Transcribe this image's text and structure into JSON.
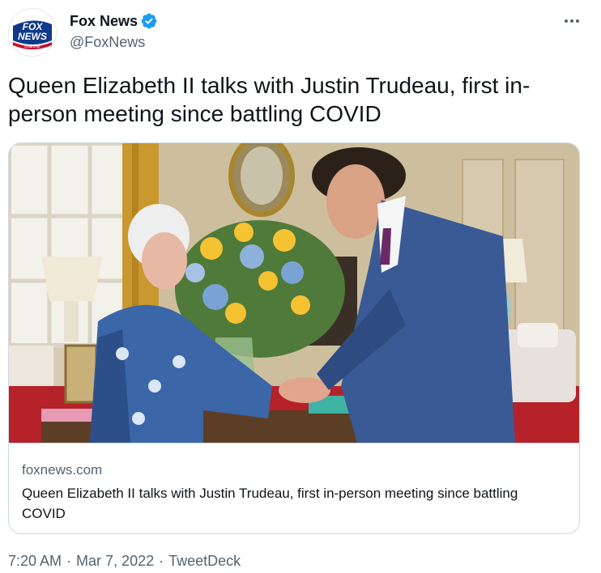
{
  "author": {
    "name": "Fox News",
    "handle": "@FoxNews",
    "verified": true,
    "avatar_logo": {
      "line1": "FOX",
      "line2": "NEWS",
      "line3": "channel"
    }
  },
  "tweet": {
    "text": "Queen Elizabeth II talks with Justin Trudeau, first in-person meeting since battling COVID"
  },
  "card": {
    "domain": "foxnews.com",
    "title": "Queen Elizabeth II talks with Justin Trudeau, first in-person meeting since battling COVID"
  },
  "meta": {
    "time": "7:20 AM",
    "date": "Mar 7, 2022",
    "source": "TweetDeck",
    "separator": "·"
  },
  "colors": {
    "verified_blue": "#1d9bf0",
    "secondary_text": "#536471",
    "primary_text": "#0f1419",
    "border": "#cfd9de"
  },
  "icons": [
    "verified-badge-icon",
    "more-options-icon"
  ]
}
